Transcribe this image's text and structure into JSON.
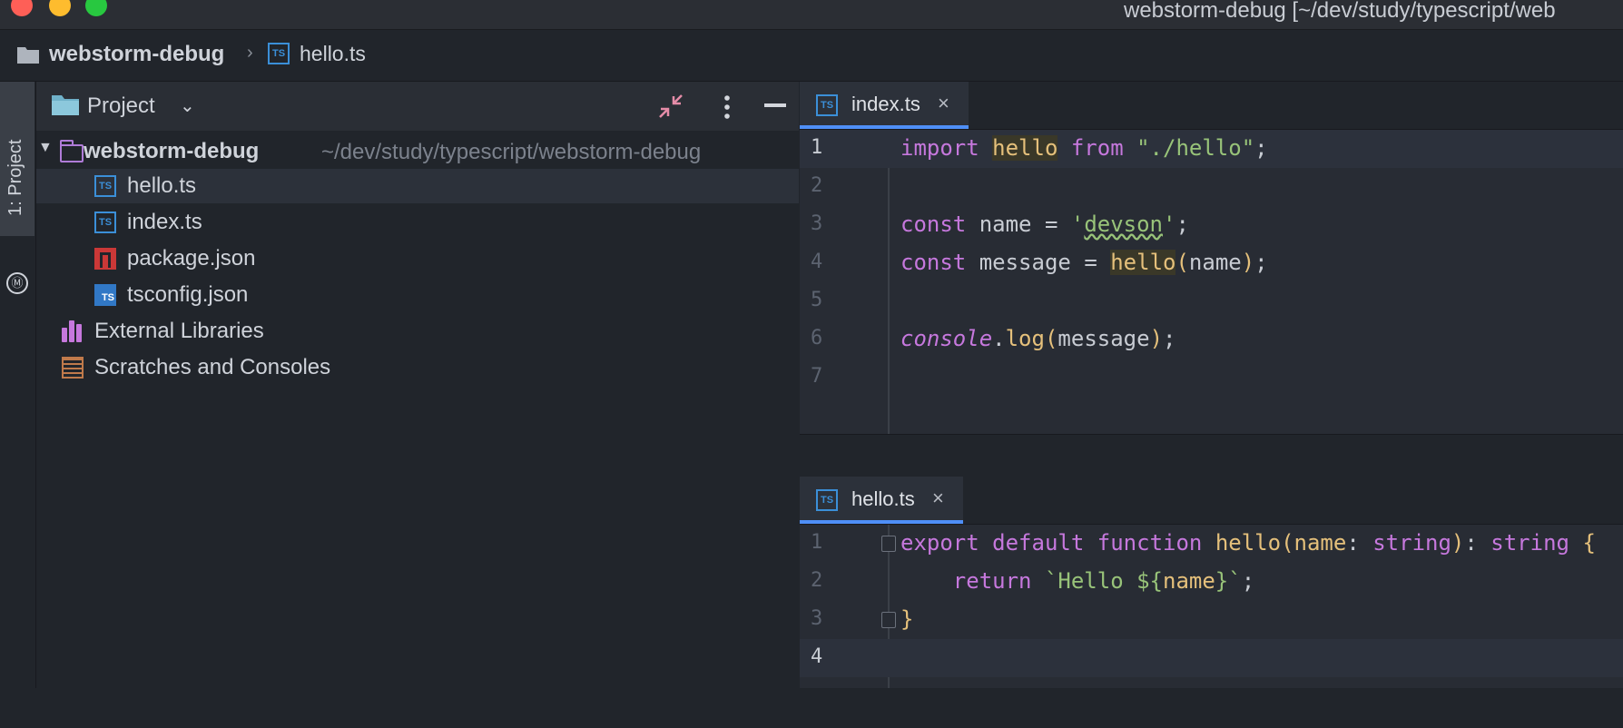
{
  "window": {
    "title": "webstorm-debug [~/dev/study/typescript/web"
  },
  "navbar": {
    "project": "webstorm-debug",
    "separator": "›",
    "file": "hello.ts"
  },
  "tool_strip": {
    "tab_label": "1: Project",
    "tab_icon": "Ⓜ"
  },
  "project_panel": {
    "title": "Project",
    "chevron": "⌄",
    "tree": [
      {
        "label": "webstorm-debug",
        "path": "~/dev/study/typescript/webstorm-debug",
        "icon": "folder-icon",
        "expanded": true
      },
      {
        "label": "hello.ts",
        "icon": "typescript-icon",
        "selected": true
      },
      {
        "label": "index.ts",
        "icon": "typescript-icon"
      },
      {
        "label": "package.json",
        "icon": "npm-icon"
      },
      {
        "label": "tsconfig.json",
        "icon": "tsconfig-icon"
      },
      {
        "label": "External Libraries",
        "icon": "library-icon"
      },
      {
        "label": "Scratches and Consoles",
        "icon": "scratch-icon"
      }
    ],
    "tree_arrow": "▼"
  },
  "icons": {
    "typescript_label": "TS",
    "close": "×"
  },
  "editor_top": {
    "tab": "index.ts",
    "lines": [
      "1",
      "2",
      "3",
      "4",
      "5",
      "6",
      "7"
    ]
  },
  "editor_bottom": {
    "tab": "hello.ts",
    "lines": [
      "1",
      "2",
      "3",
      "4"
    ]
  },
  "code_tokens": {
    "import": "import",
    "hello": "hello",
    "from": "from",
    "path_str": "\"./hello\"",
    "semi": ";",
    "const": "const",
    "name": "name",
    "eq": "=",
    "q": "'",
    "devson": "devson",
    "message": "message",
    "lp": "(",
    "rp": ")",
    "console": "console",
    "dot": ".",
    "log": "log",
    "export": "export",
    "default": "default",
    "function": "function",
    "colon": ":",
    "string": "string",
    "lbrace": "{",
    "rbrace": "}",
    "return": "return",
    "tpl_start": "`Hello $",
    "tpl_end": "`"
  },
  "colors": {
    "accent": "#4f8ff7",
    "keyword": "#c678dd",
    "function": "#e5c07b",
    "string": "#98c379"
  }
}
